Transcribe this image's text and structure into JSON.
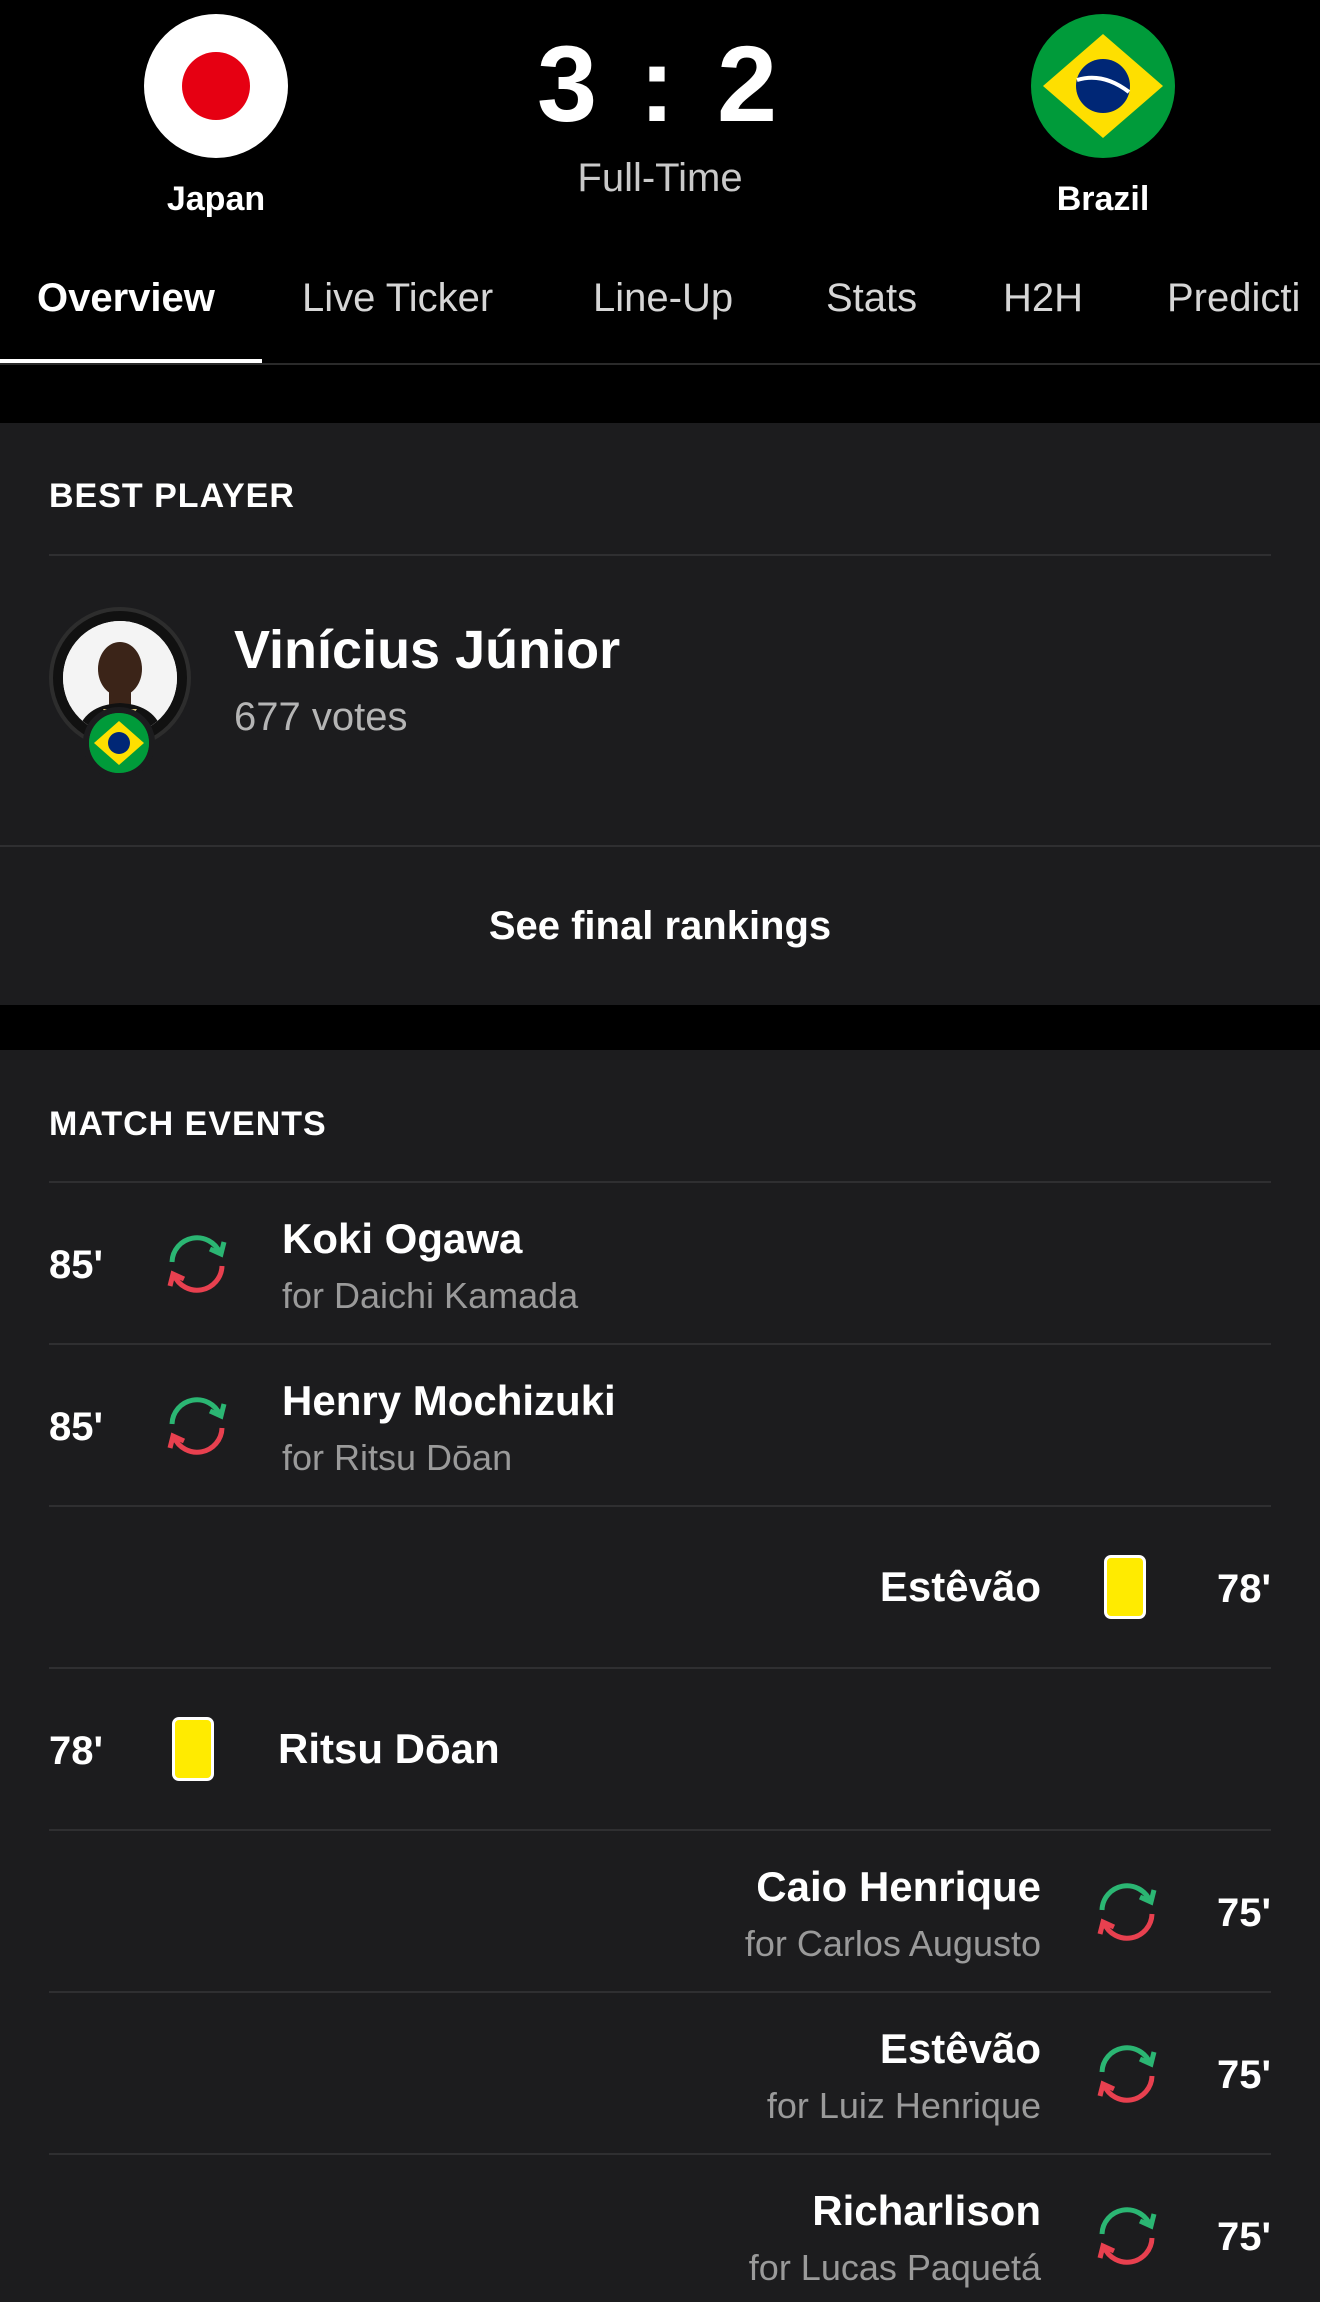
{
  "match": {
    "home": {
      "name": "Japan"
    },
    "away": {
      "name": "Brazil"
    },
    "score": "3 : 2",
    "status": "Full-Time"
  },
  "tabs": [
    {
      "label": "Overview",
      "active": true
    },
    {
      "label": "Live Ticker"
    },
    {
      "label": "Line-Up"
    },
    {
      "label": "Stats"
    },
    {
      "label": "H2H"
    },
    {
      "label": "Predicti"
    }
  ],
  "best_player": {
    "title": "BEST PLAYER",
    "name": "Vinícius Júnior",
    "votes": "677 votes",
    "rankings_label": "See final rankings"
  },
  "match_events": {
    "title": "MATCH EVENTS",
    "items": [
      {
        "minute": "85'",
        "side": "home",
        "type": "substitution",
        "player": "Koki Ogawa",
        "detail": "for Daichi Kamada"
      },
      {
        "minute": "85'",
        "side": "home",
        "type": "substitution",
        "player": "Henry Mochizuki",
        "detail": "for Ritsu Dōan"
      },
      {
        "minute": "78'",
        "side": "away",
        "type": "yellow-card",
        "player": "Estêvão"
      },
      {
        "minute": "78'",
        "side": "home",
        "type": "yellow-card",
        "player": "Ritsu Dōan"
      },
      {
        "minute": "75'",
        "side": "away",
        "type": "substitution",
        "player": "Caio Henrique",
        "detail": "for Carlos Augusto"
      },
      {
        "minute": "75'",
        "side": "away",
        "type": "substitution",
        "player": "Estêvão",
        "detail": "for Luiz Henrique"
      },
      {
        "minute": "75'",
        "side": "away",
        "type": "substitution",
        "player": "Richarlison",
        "detail": "for Lucas Paquetá"
      }
    ]
  },
  "colors": {
    "background": "#000000",
    "card": "#1c1c1e",
    "divider": "#2f2f31",
    "yellow_card": "#ffeb00",
    "sub_in": "#2bb673",
    "sub_out": "#e8404f"
  }
}
